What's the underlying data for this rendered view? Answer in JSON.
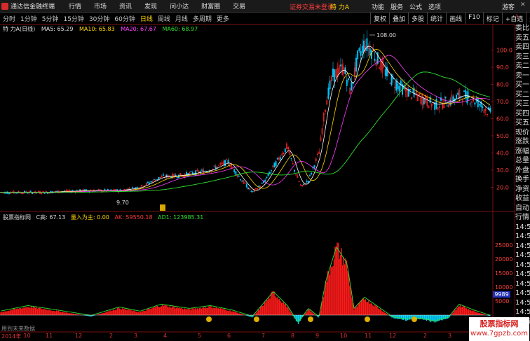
{
  "app": {
    "title": "通达信金融终端"
  },
  "menu": [
    "行情",
    "市场",
    "资讯",
    "发现",
    "问小达",
    "财富圈",
    "交易"
  ],
  "status": {
    "login": "证券交易未登录",
    "stock": "特 力A"
  },
  "right_menu": [
    "功能",
    "服务",
    "公式",
    "选项"
  ],
  "guest": "游客",
  "timeframes": [
    "分时",
    "1分钟",
    "5分钟",
    "15分钟",
    "30分钟",
    "60分钟",
    "日线",
    "周线",
    "月线",
    "多周期",
    "更多"
  ],
  "active_timeframe": "日线",
  "tools": [
    "复权",
    "叠加",
    "多股",
    "统计",
    "画线",
    "F10",
    "标记",
    "+自选",
    "返回"
  ],
  "ma_bar": {
    "name": "特 力A(日线)",
    "ma5": "MA5: 65.29",
    "ma10": "MA10: 65.83",
    "ma20": "MA20: 67.67",
    "ma60": "MA60: 68.97"
  },
  "indicator_bar": {
    "name": "股票指标网",
    "c": "C高: 67.13",
    "lead": "量入为主: 0.00",
    "ak": "AK: 59550.18",
    "ad": "AD1: 123985.31"
  },
  "price_axis": [
    "100.0",
    "90.0",
    "80.0",
    "70.0",
    "60.0",
    "50.0",
    "40.0",
    "30.0",
    "20.0"
  ],
  "high_label": "108.00",
  "low_label": "9.70",
  "ind_axis": [
    "25000",
    "20000",
    "15000",
    "10000",
    "5000"
  ],
  "cursor_value": "9989",
  "dates": [
    {
      "label": "2014年",
      "pos": 0.0
    },
    {
      "label": "10",
      "pos": 0.045
    },
    {
      "label": "11",
      "pos": 0.09
    },
    {
      "label": "12",
      "pos": 0.15
    },
    {
      "label": "2",
      "pos": 0.22
    },
    {
      "label": "3",
      "pos": 0.27
    },
    {
      "label": "4",
      "pos": 0.33
    },
    {
      "label": "5",
      "pos": 0.4
    },
    {
      "label": "6",
      "pos": 0.46
    },
    {
      "label": "7",
      "pos": 0.53
    },
    {
      "label": "8",
      "pos": 0.59
    },
    {
      "label": "9",
      "pos": 0.64
    },
    {
      "label": "10",
      "pos": 0.69
    },
    {
      "label": "11",
      "pos": 0.74
    },
    {
      "label": "12",
      "pos": 0.79
    },
    {
      "label": "2",
      "pos": 0.86
    },
    {
      "label": "3",
      "pos": 0.91
    },
    {
      "label": "4",
      "pos": 0.96
    }
  ],
  "side_panel": [
    "委比",
    "卖五",
    "卖四",
    "卖三",
    "卖二",
    "卖一",
    "买一",
    "买二",
    "买三",
    "买四",
    "买五",
    "现价",
    "涨跌",
    "涨幅",
    "总量",
    "外盘",
    "换手",
    "净资",
    "收益",
    "自动",
    "行情",
    "14:50",
    "14:50",
    "14:50",
    "14:50",
    "14:50",
    "14:50",
    "14:50",
    "14:50",
    "14:50",
    "14:50",
    "14:50"
  ],
  "no_data": "用到未来数据",
  "watermark": {
    "line1": "股票指标网",
    "line2": "www.7gpzb.com"
  },
  "colors": {
    "up": "#ff2a2a",
    "down": "#00c8ff",
    "ma5": "#ffffff",
    "ma10": "#ffd700",
    "ma20": "#ff40ff",
    "ma60": "#30e030"
  }
}
